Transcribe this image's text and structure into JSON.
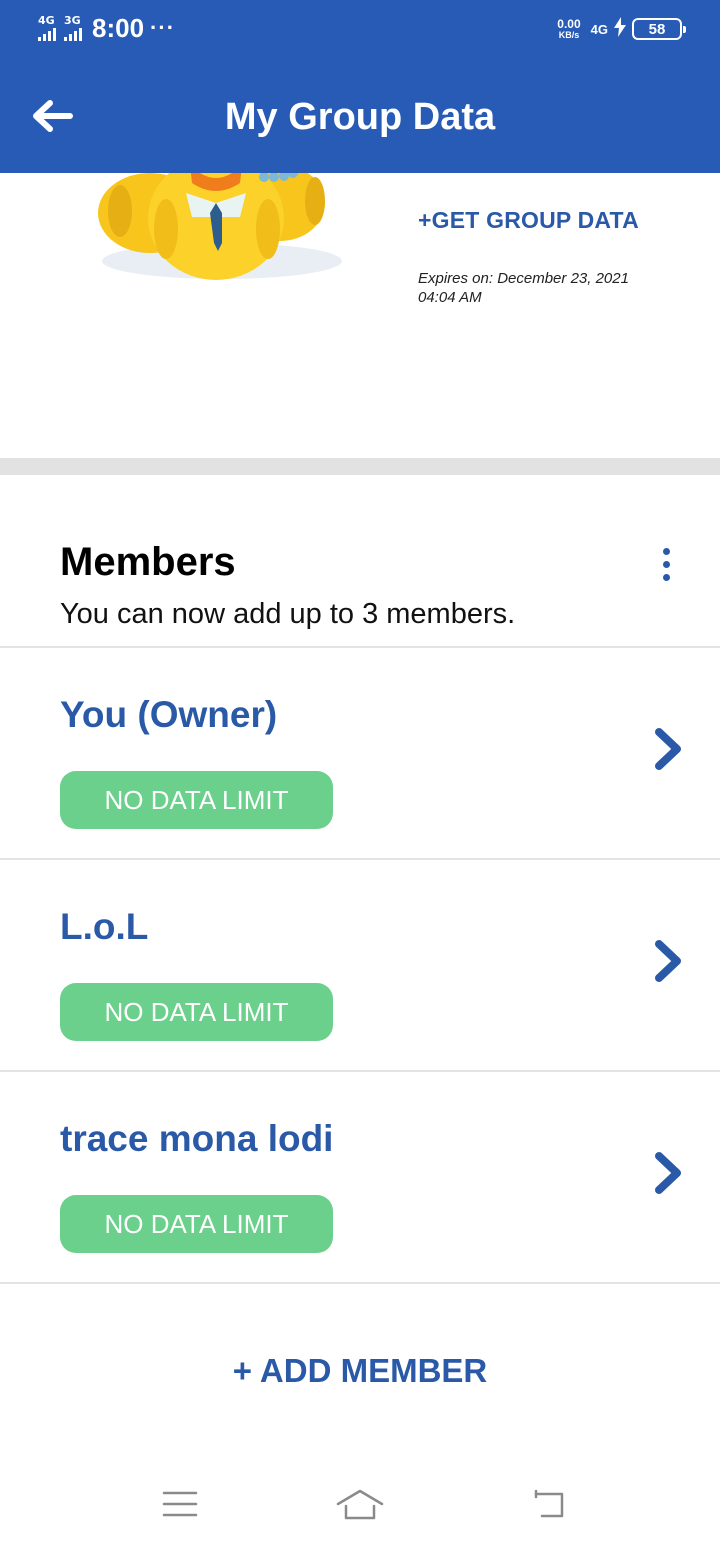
{
  "status_bar": {
    "net1": "4G",
    "net2": "3G",
    "time": "8:00",
    "dots": "···",
    "speed_value": "0.00",
    "speed_unit": "KB/s",
    "net3": "4G",
    "battery": "58"
  },
  "header": {
    "title": "My Group Data",
    "back_icon": "arrow-left-icon"
  },
  "promo": {
    "get_data_label": "+GET GROUP DATA",
    "expires": "Expires on: December 23, 2021 04:04 AM"
  },
  "members": {
    "title": "Members",
    "subtitle": "You can now add up to 3 members.",
    "items": [
      {
        "name": "You (Owner)",
        "limit": "NO DATA LIMIT"
      },
      {
        "name": "L.o.L",
        "limit": "NO DATA LIMIT"
      },
      {
        "name": "trace mona lodi",
        "limit": "NO DATA LIMIT"
      }
    ],
    "add_label": "+ ADD MEMBER"
  },
  "colors": {
    "header_bg": "#275bb5",
    "accent": "#2a59a7",
    "badge_green": "#6bd08c",
    "separator": "#e2e2e2"
  },
  "navbar": {
    "icons": [
      "menu-icon",
      "home-icon",
      "back-icon"
    ]
  }
}
